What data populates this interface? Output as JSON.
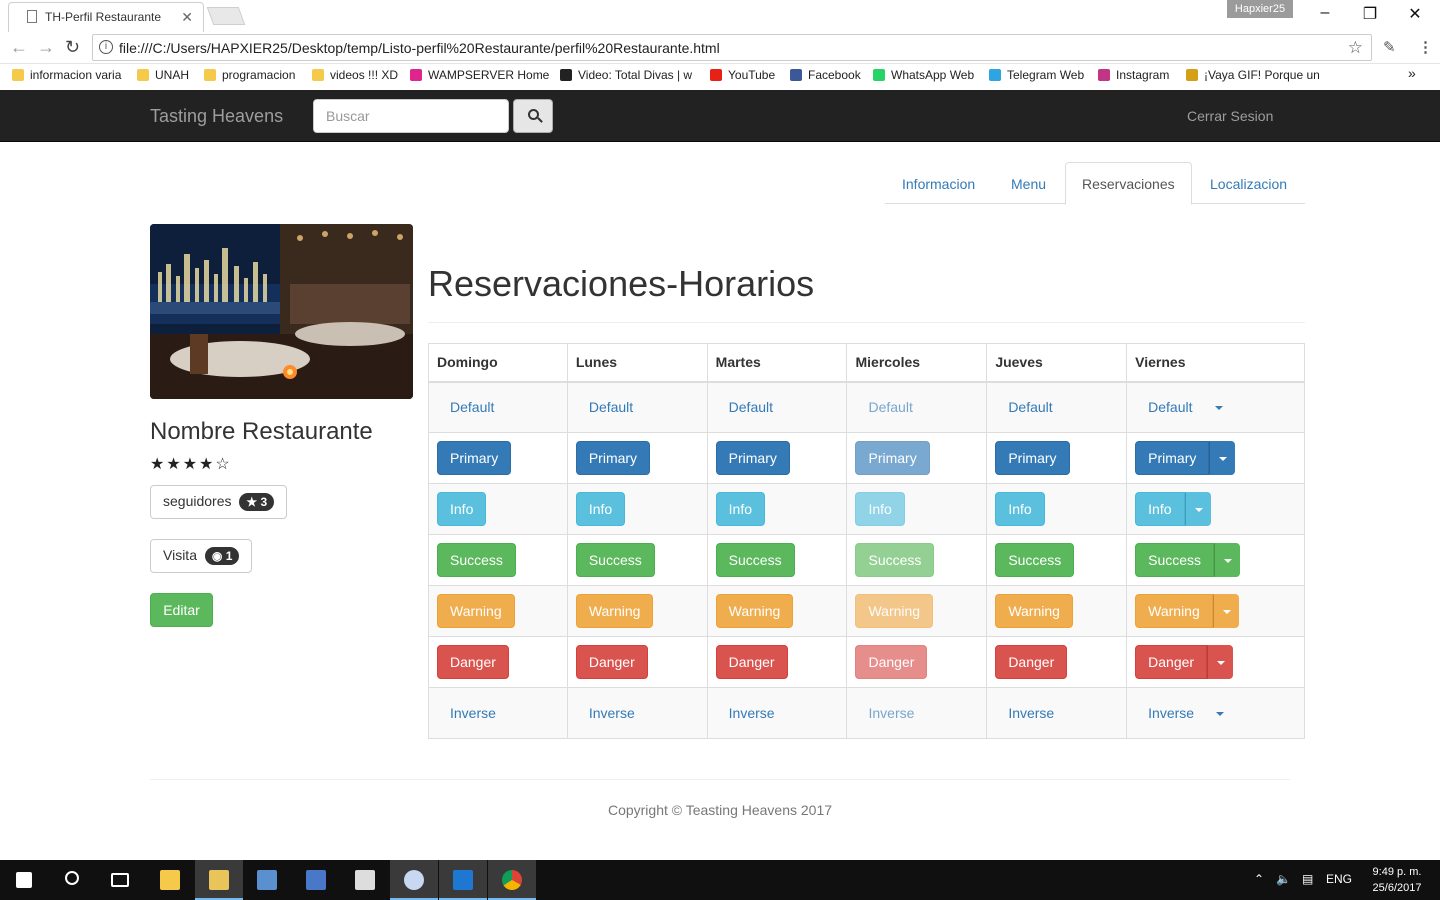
{
  "browser": {
    "tab_title": "TH-Perfil Restaurante",
    "profile_name": "Hapxier25",
    "url": "file:///C:/Users/HAPXIER25/Desktop/temp/Listo-perfil%20Restaurante/perfil%20Restaurante.html",
    "bookmarks": [
      {
        "label": "informacion varia",
        "icon": "folder-icon",
        "color": "#f5c94a"
      },
      {
        "label": "UNAH",
        "icon": "folder-icon",
        "color": "#f5c94a"
      },
      {
        "label": "programacion",
        "icon": "folder-icon",
        "color": "#f5c94a"
      },
      {
        "label": "videos !!! XD",
        "icon": "folder-icon",
        "color": "#f5c94a"
      },
      {
        "label": "WAMPSERVER Home",
        "icon": "wamp-icon",
        "color": "#e0248f"
      },
      {
        "label": "Video: Total Divas | w",
        "icon": "wwe-icon",
        "color": "#222222"
      },
      {
        "label": "YouTube",
        "icon": "youtube-icon",
        "color": "#e62117"
      },
      {
        "label": "Facebook",
        "icon": "facebook-icon",
        "color": "#3b5998"
      },
      {
        "label": "WhatsApp Web",
        "icon": "whatsapp-icon",
        "color": "#25d366"
      },
      {
        "label": "Telegram Web",
        "icon": "telegram-icon",
        "color": "#2ca5e0"
      },
      {
        "label": "Instagram",
        "icon": "instagram-icon",
        "color": "#c13584"
      },
      {
        "label": "¡Vaya GIF! Porque un",
        "icon": "gif-icon",
        "color": "#d4a017"
      }
    ],
    "more_bookmarks": "»"
  },
  "navbar": {
    "brand": "Tasting Heavens",
    "search_placeholder": "Buscar",
    "logout": "Cerrar Sesion"
  },
  "tabs": [
    {
      "label": "Informacion",
      "active": false
    },
    {
      "label": "Menu",
      "active": false
    },
    {
      "label": "Reservaciones",
      "active": true
    },
    {
      "label": "Localizacion",
      "active": false
    }
  ],
  "profile": {
    "name": "Nombre Restaurante",
    "rating_text": "★★★★☆",
    "rating": 4,
    "followers_label": "seguidores",
    "followers_count": "3",
    "visits_label": "Visita",
    "visits_count": "1",
    "edit_label": "Editar"
  },
  "schedule": {
    "title": "Reservaciones-Horarios",
    "days": [
      "Domingo",
      "Lunes",
      "Martes",
      "Miercoles",
      "Jueves",
      "Viernes"
    ],
    "rows": [
      {
        "label": "Default",
        "style": "link"
      },
      {
        "label": "Primary",
        "style": "primary"
      },
      {
        "label": "Info",
        "style": "info"
      },
      {
        "label": "Success",
        "style": "success"
      },
      {
        "label": "Warning",
        "style": "warning"
      },
      {
        "label": "Danger",
        "style": "danger"
      },
      {
        "label": "Inverse",
        "style": "link"
      }
    ],
    "disabled_day": "Miercoles",
    "split_day": "Viernes"
  },
  "footer": {
    "copyright": "Copyright © Teasting Heavens 2017"
  },
  "taskbar": {
    "language": "ENG",
    "time": "9:49 p. m.",
    "date": "25/6/2017"
  }
}
